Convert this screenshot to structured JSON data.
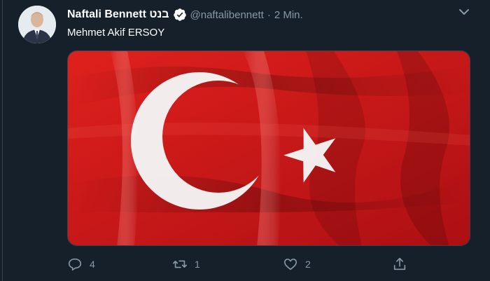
{
  "tweet": {
    "author": {
      "display_name": "Naftali Bennett בנט",
      "handle": "@naftalibennett",
      "verified": true,
      "avatar": "profile-photo"
    },
    "separator": "·",
    "timestamp": "2 Min.",
    "text": "Mehmet Akif ERSOY",
    "media": {
      "type": "image",
      "description_icon": "turkish-flag-photo",
      "colors": {
        "flag_red": "#d7191c",
        "flag_white": "#ffffff"
      }
    },
    "actions": {
      "reply_count": "4",
      "retweet_count": "1",
      "like_count": "2"
    }
  },
  "theme": {
    "background": "#15202b",
    "secondary_text": "#8899a6",
    "primary_text": "#ffffff",
    "verified_color": "#ffffff"
  }
}
